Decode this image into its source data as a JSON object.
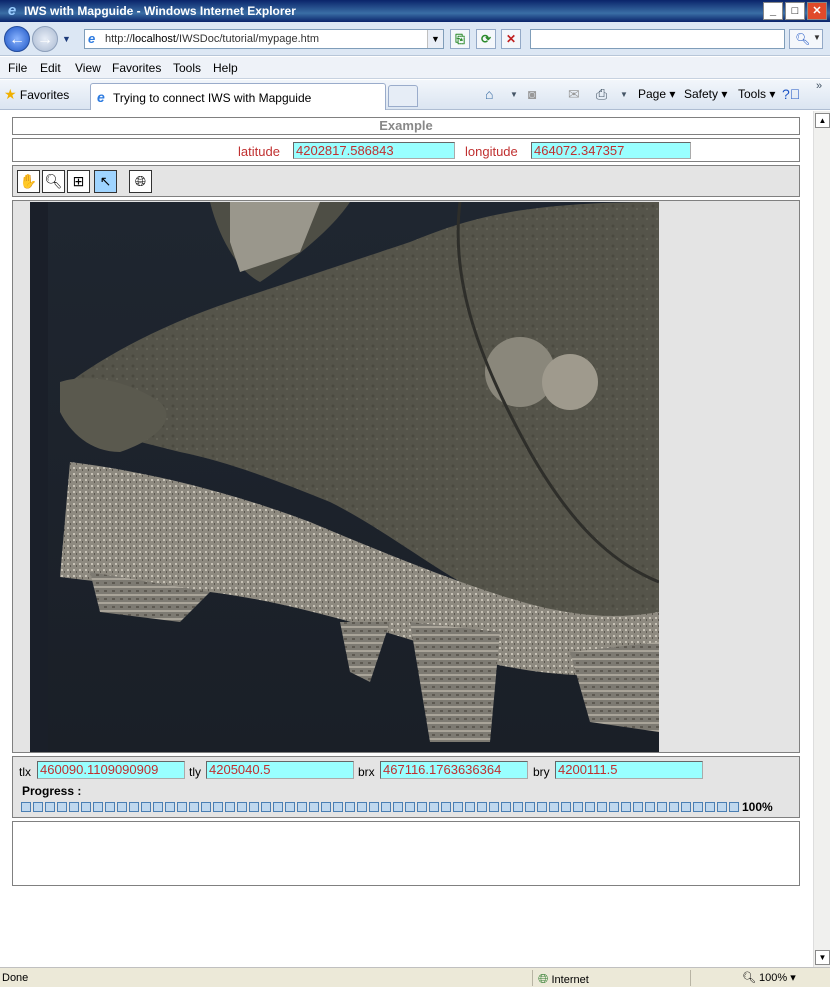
{
  "window": {
    "title": "IWS with Mapguide - Windows Internet Explorer",
    "minimize": "_",
    "maximize": "□",
    "close": "✕"
  },
  "address": {
    "url_prefix": "http://",
    "url_host": "localhost",
    "url_path": "/IWSDoc/tutorial/mypage.htm",
    "search_placeholder": ""
  },
  "menu": [
    "File",
    "Edit",
    "View",
    "Favorites",
    "Tools",
    "Help"
  ],
  "tabs": {
    "favorites_label": "Favorites",
    "active_tab": "Trying to connect IWS with Mapguide"
  },
  "command_bar": {
    "page": "Page",
    "safety": "Safety",
    "tools": "Tools"
  },
  "page": {
    "title": "Example",
    "latitude_label": "latitude",
    "latitude_value": "4202817.586843",
    "longitude_label": "longitude",
    "longitude_value": "464072.347357",
    "tools": [
      "pan-tool",
      "zoom-in-tool",
      "zoom-window-tool",
      "select-tool",
      "full-extent-tool"
    ],
    "extent": {
      "tlx_label": "tlx",
      "tlx_value": "460090.1109090909",
      "tly_label": "tly",
      "tly_value": "4205040.5",
      "brx_label": "brx",
      "brx_value": "467116.1763636364",
      "bry_label": "bry",
      "bry_value": "4200111.5"
    },
    "progress_label": "Progress :",
    "progress_percent": "100%",
    "progress_fraction": 1.0
  },
  "status": {
    "text": "Done",
    "zone": "Internet",
    "zoom": "100%"
  },
  "colors": {
    "field_bg": "#99ffff",
    "field_text": "#c03030",
    "panel_bg": "#e4e4e4"
  }
}
